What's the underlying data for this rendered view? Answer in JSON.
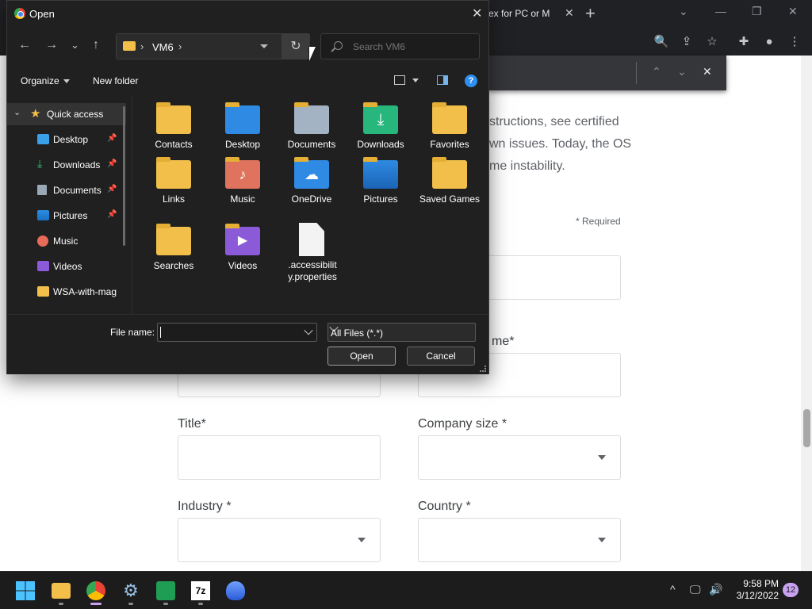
{
  "browser": {
    "tab_title": "ex for PC or M",
    "new_tab_glyph": "+",
    "window_controls": {
      "minimize": "—",
      "restore": "❐",
      "close": "✕"
    },
    "find_bar": {
      "prev": "⌃",
      "next": "⌄",
      "close": "✕"
    },
    "page": {
      "text_lines": [
        "structions, see certified",
        "wn issues. Today, the OS",
        "me instability."
      ],
      "required_note": "* Required",
      "fields": {
        "name_label": "me*",
        "title_label": "Title*",
        "company_size_label": "Company size *",
        "industry_label": "Industry *",
        "country_label": "Country *"
      }
    }
  },
  "dialog": {
    "title": "Open",
    "close_glyph": "✕",
    "nav": {
      "back": "←",
      "forward": "→",
      "recent": "⌄",
      "up": "↑"
    },
    "address": {
      "crumb": "VM6",
      "sep": "›"
    },
    "refresh_glyph": "↻",
    "search": {
      "placeholder": "Search VM6"
    },
    "commands": {
      "organize": "Organize",
      "new_folder": "New folder",
      "help": "?"
    },
    "nav_pane": [
      {
        "label": "Quick access",
        "icon": "star-icon"
      },
      {
        "label": "Desktop",
        "icon": "desktop-icon",
        "pinned": true
      },
      {
        "label": "Downloads",
        "icon": "download-icon",
        "pinned": true
      },
      {
        "label": "Documents",
        "icon": "documents-icon",
        "pinned": true
      },
      {
        "label": "Pictures",
        "icon": "pictures-icon",
        "pinned": true
      },
      {
        "label": "Music",
        "icon": "music-icon"
      },
      {
        "label": "Videos",
        "icon": "videos-icon"
      },
      {
        "label": "WSA-with-mag",
        "icon": "folder-icon"
      }
    ],
    "pin_glyph": "📌",
    "files": [
      {
        "label": "Contacts",
        "icon": "folder-icon"
      },
      {
        "label": "Desktop",
        "icon": "desktop-folder-icon"
      },
      {
        "label": "Documents",
        "icon": "documents-folder-icon"
      },
      {
        "label": "Downloads",
        "icon": "downloads-folder-icon"
      },
      {
        "label": "Favorites",
        "icon": "folder-icon"
      },
      {
        "label": "Links",
        "icon": "folder-icon"
      },
      {
        "label": "Music",
        "icon": "music-folder-icon"
      },
      {
        "label": "OneDrive",
        "icon": "onedrive-icon"
      },
      {
        "label": "Pictures",
        "icon": "pictures-folder-icon"
      },
      {
        "label": "Saved Games",
        "icon": "folder-icon"
      },
      {
        "label": "Searches",
        "icon": "folder-icon"
      },
      {
        "label": "Videos",
        "icon": "videos-folder-icon"
      },
      {
        "label": ".accessibility.properties",
        "icon": "file-icon"
      }
    ],
    "file_name_label": "File name:",
    "file_name_value": "",
    "file_type": "All Files (*.*)",
    "open_button": "Open",
    "cancel_button": "Cancel"
  },
  "taskbar": {
    "apps": [
      "start-icon",
      "file-explorer-icon",
      "chrome-icon",
      "settings-icon",
      "excel-icon",
      "7zip-icon",
      "app-icon"
    ],
    "sevenzip_text": "7z",
    "tray": {
      "chevron": "^",
      "network": "🖵",
      "volume": "🔊"
    },
    "time": "9:58 PM",
    "date": "3/12/2022",
    "notifications": "12"
  },
  "colors": {
    "folder": "#f2c04a",
    "accent": "#2f8ff0",
    "dialog_bg": "#202020"
  }
}
